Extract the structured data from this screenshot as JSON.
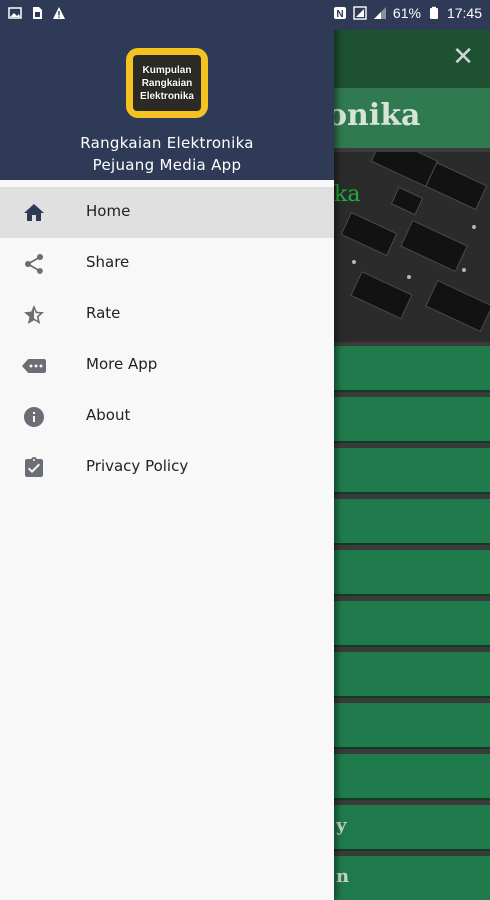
{
  "status_bar": {
    "battery_percent": "61%",
    "time": "17:45",
    "left_icons": [
      "image-icon",
      "sim-card-icon",
      "warning-icon"
    ],
    "right_icons": [
      "nfc-icon",
      "signal-box-icon",
      "signal-icon",
      "battery-icon"
    ]
  },
  "background_app": {
    "title_partial": "onika",
    "banner_text_partial": "ka",
    "list_item_texts": [
      "",
      "",
      "",
      "",
      "",
      "",
      "",
      "",
      "",
      "y",
      "n"
    ],
    "colors": {
      "toolbar": "#1d5131",
      "title_bar": "#2f7a4f",
      "list_item": "#1f7a4c"
    }
  },
  "drawer": {
    "header": {
      "logo_lines": [
        "Kumpulan",
        "Rangkaian",
        "Elektronika"
      ],
      "app_name_line1": "Rangkaian Elektronika",
      "app_name_line2": "Pejuang Media App"
    },
    "menu": [
      {
        "label": "Home",
        "icon": "home-icon",
        "active": true
      },
      {
        "label": "Share",
        "icon": "share-icon",
        "active": false
      },
      {
        "label": "Rate",
        "icon": "star-half-icon",
        "active": false
      },
      {
        "label": "More App",
        "icon": "more-tag-icon",
        "active": false
      },
      {
        "label": "About",
        "icon": "info-icon",
        "active": false
      },
      {
        "label": "Privacy Policy",
        "icon": "clipboard-check-icon",
        "active": false
      }
    ],
    "colors": {
      "header": "#2f3a57",
      "icon": "#5f6368",
      "active_icon": "#2f3a57",
      "active_bg": "#e0e0e0"
    }
  }
}
